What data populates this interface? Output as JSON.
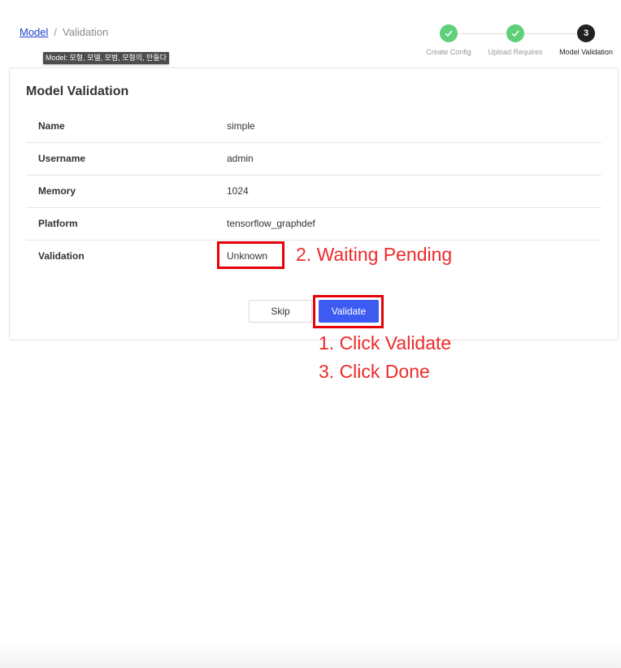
{
  "breadcrumb": {
    "link": "Model",
    "separator": "/",
    "current": "Validation"
  },
  "tooltip": "Model: 모형, 모델, 모범, 모형의, 만들다",
  "steps": [
    {
      "label": "Create Config",
      "status": "done",
      "number": ""
    },
    {
      "label": "Upload Requires",
      "status": "done",
      "number": ""
    },
    {
      "label": "Model Validation",
      "status": "active",
      "number": "3"
    }
  ],
  "card": {
    "title": "Model Validation",
    "rows": [
      {
        "label": "Name",
        "value": "simple"
      },
      {
        "label": "Username",
        "value": "admin"
      },
      {
        "label": "Memory",
        "value": "1024"
      },
      {
        "label": "Platform",
        "value": "tensorflow_graphdef"
      },
      {
        "label": "Validation",
        "value": "Unknown"
      }
    ],
    "skip_label": "Skip",
    "validate_label": "Validate"
  },
  "annotations": {
    "waiting": "2. Waiting Pending",
    "click_validate": "1. Click Validate",
    "click_done": "3. Click Done"
  },
  "colors": {
    "primary": "#3d5af1",
    "done_step": "#5fcf79",
    "annotation": "#e6000a"
  }
}
